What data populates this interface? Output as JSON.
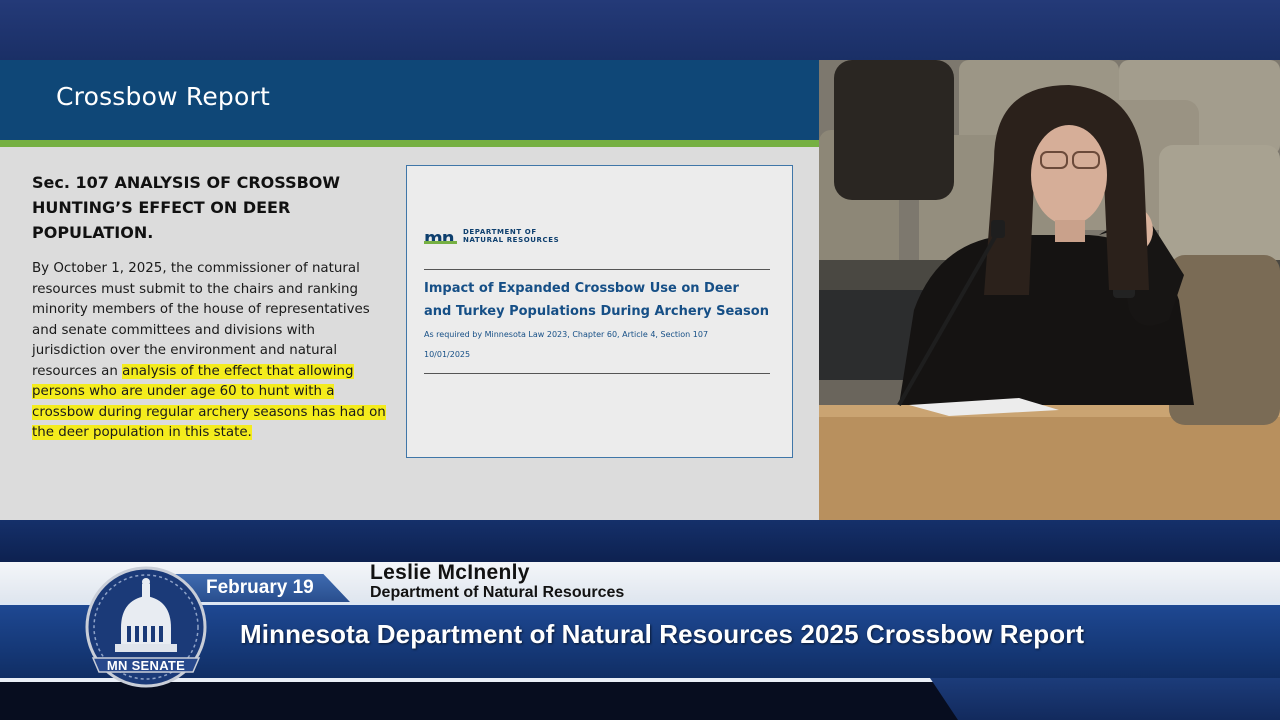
{
  "slide": {
    "title": "Crossbow Report",
    "section_heading": "Sec. 107 ANALYSIS OF CROSSBOW HUNTING’S EFFECT ON DEER POPULATION.",
    "body_plain": "By October 1, 2025, the commissioner of natural resources must submit to the chairs and ranking minority members of the house of representatives and senate committees and divisions with jurisdiction over the environment and natural resources an ",
    "body_highlight": "analysis of the effect that allowing persons who are under age 60 to hunt with a crossbow during regular archery seasons has had on the deer population in this state.",
    "highlight_color": "#f4ec1d",
    "report_cover": {
      "logo_mark": "mn",
      "logo_line1": "DEPARTMENT OF",
      "logo_line2": "NATURAL RESOURCES",
      "title": "Impact of Expanded Crossbow Use on Deer and Turkey Populations During Archery Season",
      "requirement": "As required by Minnesota Law 2023, Chapter 60, Article 4, Section 107",
      "date": "10/01/2025"
    }
  },
  "camera": {
    "subject": "speaker-video-feed"
  },
  "lower_third": {
    "date": "February 19",
    "speaker_name": "Leslie McInenly",
    "speaker_org": "Department of Natural Resources",
    "program_title": "Minnesota Department of Natural Resources 2025 Crossbow Report",
    "seal_label": "MN SENATE"
  },
  "colors": {
    "slide_header": "#0f4777",
    "accent_green": "#76b043",
    "title_bar": "#1f4994"
  }
}
